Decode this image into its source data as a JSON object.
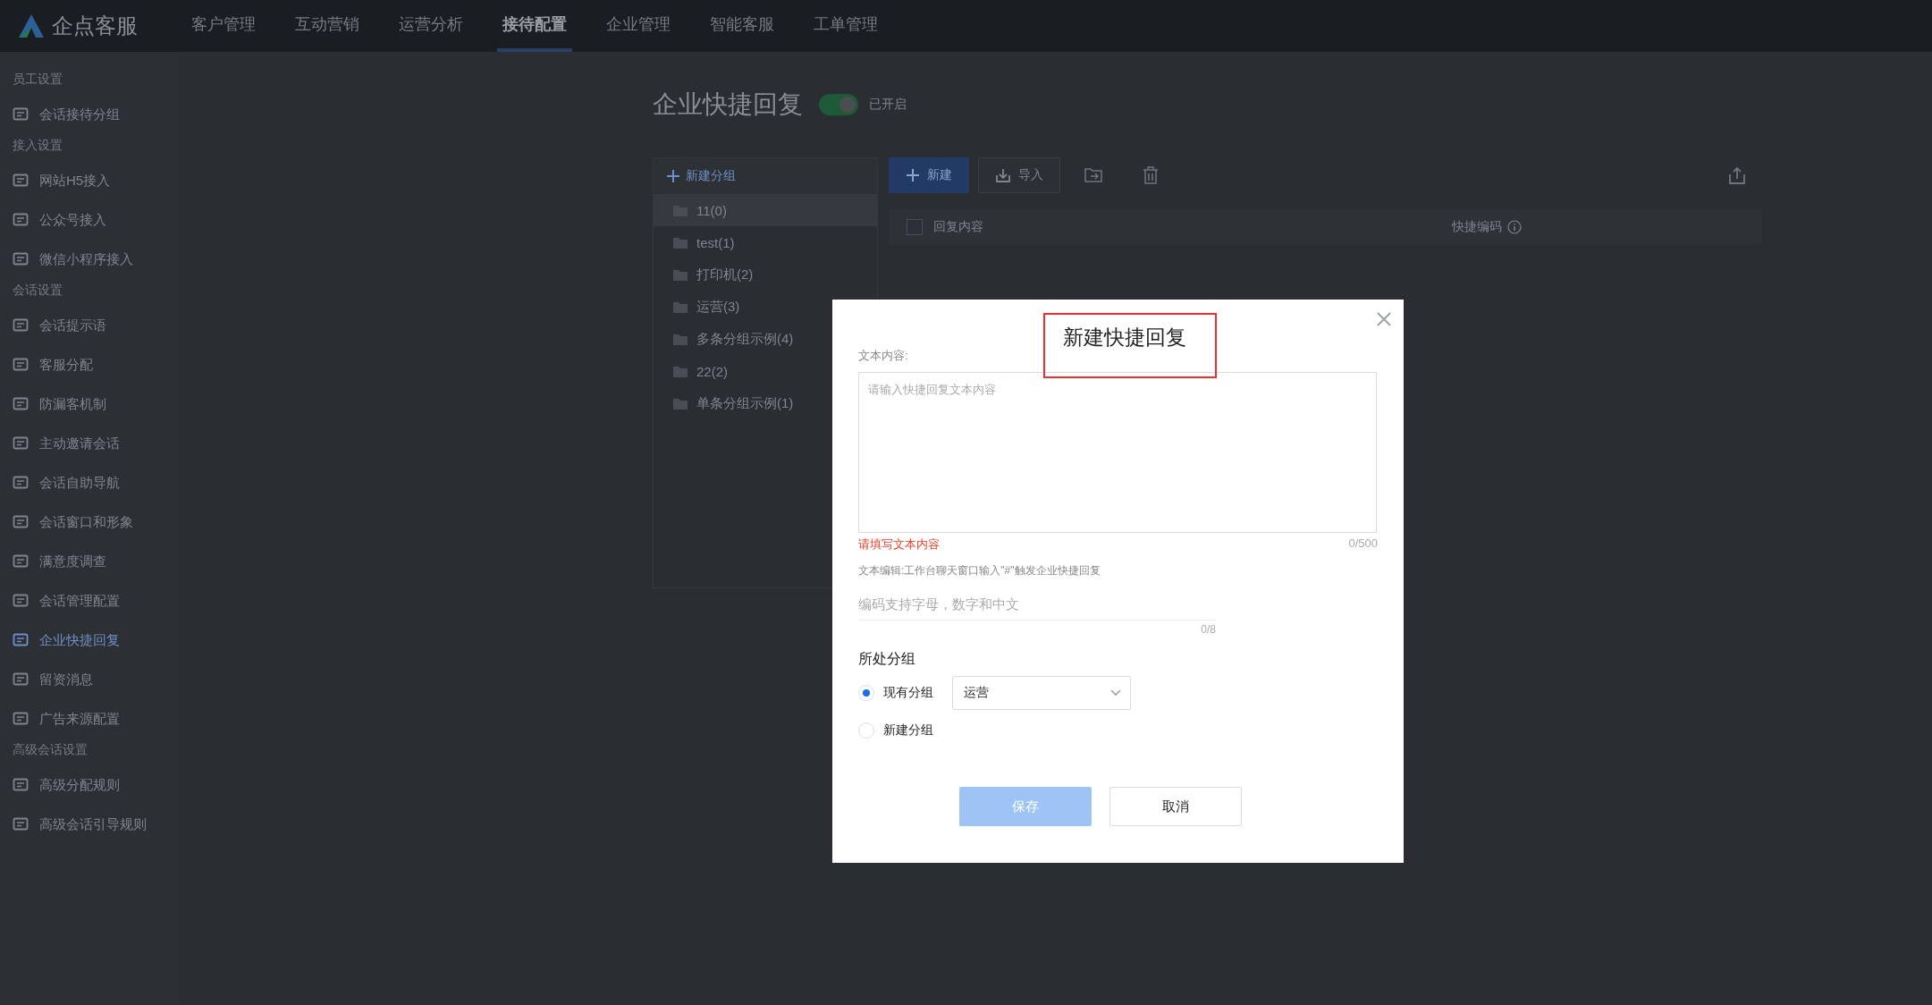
{
  "nav": {
    "logo": "企点客服",
    "items": [
      {
        "label": "客户管理",
        "selected": false
      },
      {
        "label": "互动营销",
        "selected": false
      },
      {
        "label": "运营分析",
        "selected": false
      },
      {
        "label": "接待配置",
        "selected": true
      },
      {
        "label": "企业管理",
        "selected": false
      },
      {
        "label": "智能客服",
        "selected": false
      },
      {
        "label": "工单管理",
        "selected": false
      }
    ]
  },
  "sidebar": {
    "sections": [
      {
        "title": "员工设置",
        "items": [
          {
            "label": "会话接待分组",
            "selected": false
          }
        ]
      },
      {
        "title": "接入设置",
        "items": [
          {
            "label": "网站H5接入",
            "selected": false
          },
          {
            "label": "公众号接入",
            "selected": false
          },
          {
            "label": "微信小程序接入",
            "selected": false
          }
        ]
      },
      {
        "title": "会话设置",
        "items": [
          {
            "label": "会话提示语",
            "selected": false
          },
          {
            "label": "客服分配",
            "selected": false
          },
          {
            "label": "防漏客机制",
            "selected": false
          },
          {
            "label": "主动邀请会话",
            "selected": false
          },
          {
            "label": "会话自助导航",
            "selected": false
          },
          {
            "label": "会话窗口和形象",
            "selected": false
          },
          {
            "label": "满意度调查",
            "selected": false
          },
          {
            "label": "会话管理配置",
            "selected": false
          },
          {
            "label": "企业快捷回复",
            "selected": true
          },
          {
            "label": "留资消息",
            "selected": false
          },
          {
            "label": "广告来源配置",
            "selected": false
          }
        ]
      },
      {
        "title": "高级会话设置",
        "items": [
          {
            "label": "高级分配规则",
            "selected": false
          },
          {
            "label": "高级会话引导规则",
            "selected": false
          }
        ]
      }
    ]
  },
  "page": {
    "title": "企业快捷回复",
    "toggle": {
      "on": true,
      "label": "已开启"
    }
  },
  "groups": {
    "new_button": "新建分组",
    "items": [
      {
        "label": "11(0)",
        "selected": true
      },
      {
        "label": "test(1)",
        "selected": false
      },
      {
        "label": "打印机(2)",
        "selected": false
      },
      {
        "label": "运营(3)",
        "selected": false
      },
      {
        "label": "多条分组示例(4)",
        "selected": false
      },
      {
        "label": "22(2)",
        "selected": false
      },
      {
        "label": "单条分组示例(1)",
        "selected": false
      }
    ]
  },
  "toolbar": {
    "new_button": "新建",
    "import_button": "导入"
  },
  "table": {
    "select_all": {
      "checked": false
    },
    "columns": [
      "回复内容",
      "快捷编码"
    ]
  },
  "dialog": {
    "title": "新建快捷回复",
    "content_label": "文本内容:",
    "content": {
      "placeholder": "请输入快捷回复文本内容"
    },
    "error": "请填写文本内容",
    "content_count": "0/500",
    "hint": "文本编辑:工作台聊天窗口输入\"#\"触发企业快捷回复",
    "code": {
      "placeholder": "编码支持字母，数字和中文"
    },
    "code_count": "0/8",
    "group_label": "所处分组",
    "options": [
      {
        "label": "现有分组",
        "selected": true
      },
      {
        "label": "新建分组",
        "selected": false
      }
    ],
    "group_select": "运营",
    "save_button": {
      "label": "保存",
      "disabled": true
    },
    "cancel_button": "取消"
  }
}
